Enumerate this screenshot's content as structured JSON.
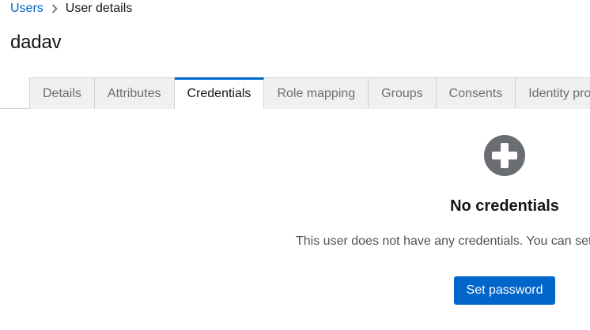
{
  "breadcrumb": {
    "parent_label": "Users",
    "current_label": "User details"
  },
  "page": {
    "title": "dadav"
  },
  "tabs": [
    {
      "label": "Details",
      "active": false
    },
    {
      "label": "Attributes",
      "active": false
    },
    {
      "label": "Credentials",
      "active": true
    },
    {
      "label": "Role mapping",
      "active": false
    },
    {
      "label": "Groups",
      "active": false
    },
    {
      "label": "Consents",
      "active": false
    },
    {
      "label": "Identity pro",
      "active": false
    }
  ],
  "empty_state": {
    "icon": "plus-circle-icon",
    "title": "No credentials",
    "body": "This user does not have any credentials. You can set p",
    "button_label": "Set password"
  },
  "colors": {
    "link": "#0066cc",
    "primary_button": "#0066cc",
    "icon": "#6a6e73",
    "tab_inactive_bg": "#f0f0f0"
  }
}
